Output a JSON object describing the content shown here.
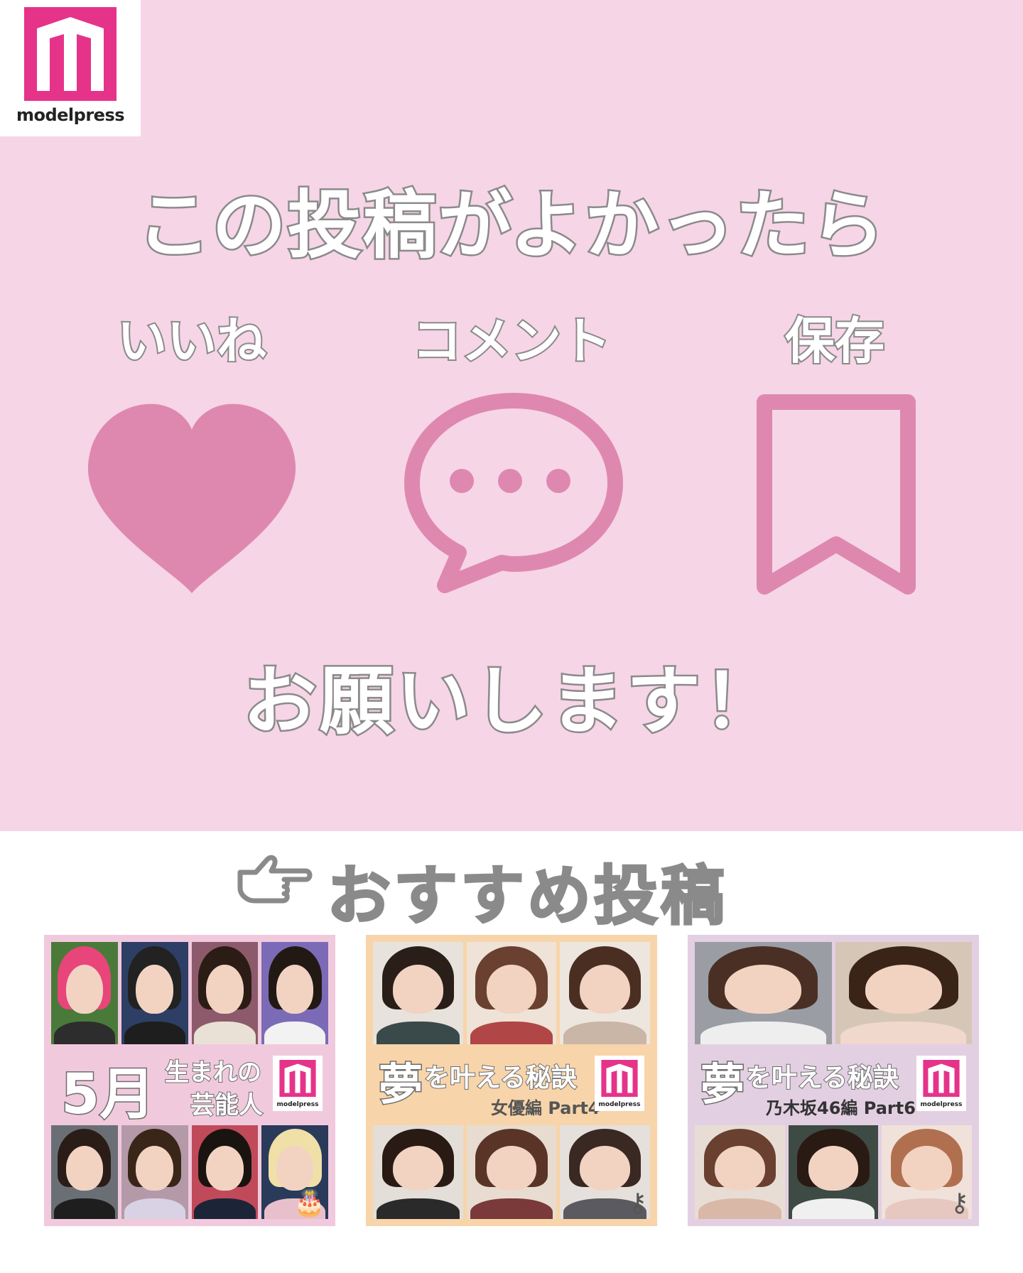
{
  "brand": {
    "name": "modelpress",
    "color": "#e6338a"
  },
  "headline": "この投稿がよかったら",
  "actions": [
    {
      "label": "いいね",
      "icon": "heart-icon"
    },
    {
      "label": "コメント",
      "icon": "comment-bubble-icon"
    },
    {
      "label": "保存",
      "icon": "bookmark-icon"
    }
  ],
  "closing": "お願いします！",
  "colors": {
    "background": "#f6d5e6",
    "icon": "#de88b0",
    "outline": "#8a8a8a"
  },
  "recommended": {
    "title": "おすすめ投稿",
    "icon": "pointing-hand-icon",
    "cards": [
      {
        "title_big": "5月",
        "title_small_1": "生まれの",
        "title_small_2": "芸能人",
        "logo": "modelpress",
        "badge": "birthday-cake-icon"
      },
      {
        "title_big": "夢",
        "title_rest": "を叶える秘訣",
        "subtitle": "女優編 Part4",
        "logo": "modelpress",
        "badge": "key-icon"
      },
      {
        "title_big": "夢",
        "title_rest": "を叶える秘訣",
        "subtitle": "乃木坂46編 Part6",
        "logo": "modelpress",
        "badge": "key-icon"
      }
    ]
  }
}
